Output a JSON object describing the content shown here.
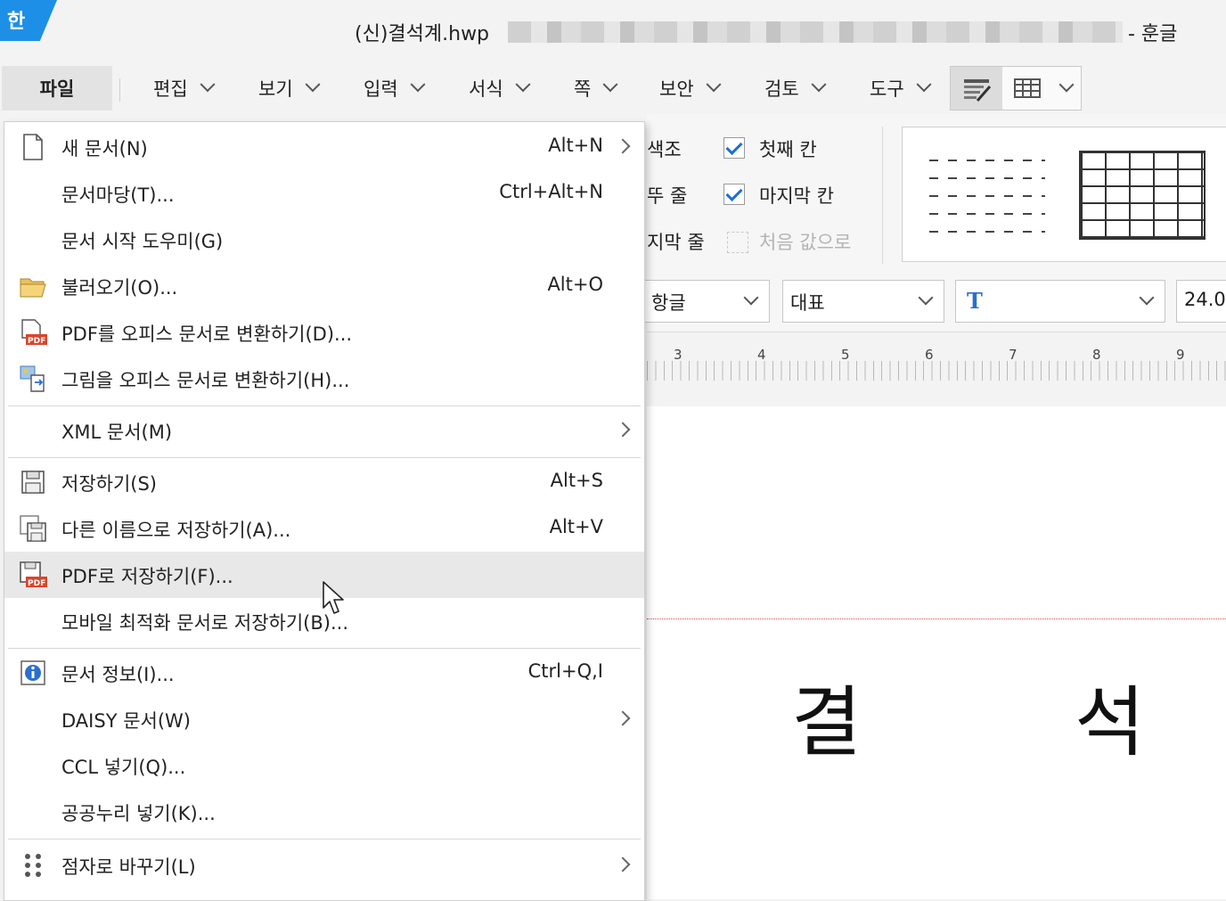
{
  "title": {
    "logo": "한",
    "document": "(신)결석계.hwp",
    "app": "- 훈글"
  },
  "menubar": {
    "file": "파일",
    "items": [
      "편집",
      "보기",
      "입력",
      "서식",
      "쪽",
      "보안",
      "검토",
      "도구"
    ]
  },
  "ribbon": {
    "left_labels": [
      "색조",
      "뚜 줄",
      "지막 줄"
    ],
    "checks": [
      {
        "label": "첫째 칸",
        "checked": true
      },
      {
        "label": "마지막 칸",
        "checked": true
      },
      {
        "label": "처음 값으로",
        "checked": false
      }
    ],
    "combos": [
      "항글",
      "대표",
      "",
      "24.0"
    ]
  },
  "ruler": {
    "numbers": [
      "3",
      "4",
      "5",
      "6",
      "7",
      "8",
      "9"
    ]
  },
  "document": {
    "chars": [
      "결",
      "석"
    ]
  },
  "file_menu": {
    "group1": [
      {
        "label": "새 문서(N)",
        "shortcut": "Alt+N",
        "icon": "new-document-icon",
        "submenu": true
      },
      {
        "label": "문서마당(T)...",
        "shortcut": "Ctrl+Alt+N"
      },
      {
        "label": "문서 시작 도우미(G)",
        "shortcut": ""
      },
      {
        "label": "불러오기(O)...",
        "shortcut": "Alt+O",
        "icon": "folder-open-icon"
      },
      {
        "label": "PDF를 오피스 문서로 변환하기(D)...",
        "shortcut": "",
        "icon": "pdf-convert-icon"
      },
      {
        "label": "그림을 오피스 문서로 변환하기(H)...",
        "shortcut": "",
        "icon": "image-convert-icon"
      }
    ],
    "group2": [
      {
        "label": "XML 문서(M)",
        "submenu": true
      }
    ],
    "group3": [
      {
        "label": "저장하기(S)",
        "shortcut": "Alt+S",
        "icon": "save-icon"
      },
      {
        "label": "다른 이름으로 저장하기(A)...",
        "shortcut": "Alt+V",
        "icon": "save-as-icon"
      },
      {
        "label": "PDF로 저장하기(F)...",
        "shortcut": "",
        "icon": "save-pdf-icon",
        "highlighted": true
      },
      {
        "label": "모바일 최적화 문서로 저장하기(B)...",
        "shortcut": ""
      }
    ],
    "group4": [
      {
        "label": "문서 정보(I)...",
        "shortcut": "Ctrl+Q,I",
        "icon": "info-icon"
      },
      {
        "label": "DAISY 문서(W)",
        "submenu": true
      },
      {
        "label": "CCL 넣기(Q)..."
      },
      {
        "label": "공공누리 넣기(K)..."
      }
    ],
    "group5": [
      {
        "label": "점자로 바꾸기(L)",
        "submenu": true,
        "icon": "braille-icon"
      }
    ]
  },
  "colors": {
    "accent": "#1e8fe6",
    "check": "#1a6fd8",
    "pdf": "#d9452c"
  }
}
